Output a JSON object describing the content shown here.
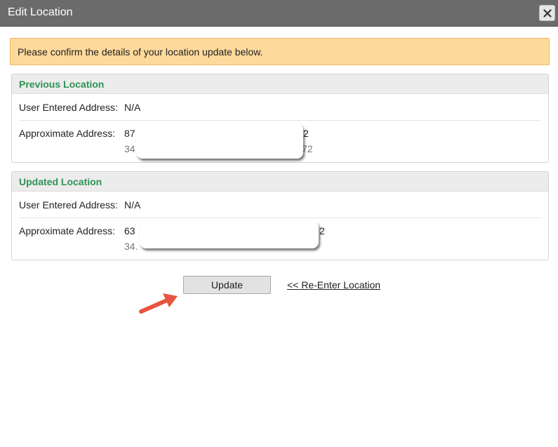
{
  "dialog": {
    "title": "Edit Location",
    "close_glyph": "✕"
  },
  "notice": {
    "text": "Please confirm the details of your location update below."
  },
  "previous_location": {
    "heading": "Previous Location",
    "user_entered_label": "User Entered Address:",
    "user_entered_value": "N/A",
    "approximate_label": "Approximate Address:",
    "approximate_line1_start": "87",
    "approximate_line1_end": "2",
    "approximate_line2_start": "34",
    "approximate_line2_end": "72"
  },
  "updated_location": {
    "heading": "Updated Location",
    "user_entered_label": "User Entered Address:",
    "user_entered_value": "N/A",
    "approximate_label": "Approximate Address:",
    "approximate_line1_start": "63",
    "approximate_line1_end": "2",
    "approximate_line2_start": "34.",
    "approximate_line2_end": ""
  },
  "actions": {
    "update_label": "Update",
    "reenter_label": "<< Re-Enter Location"
  },
  "colors": {
    "titlebar": "#6b6b6b",
    "notice_bg": "#fdd99b",
    "heading_green": "#2f9356",
    "annotation_arrow": "#e8553e"
  }
}
